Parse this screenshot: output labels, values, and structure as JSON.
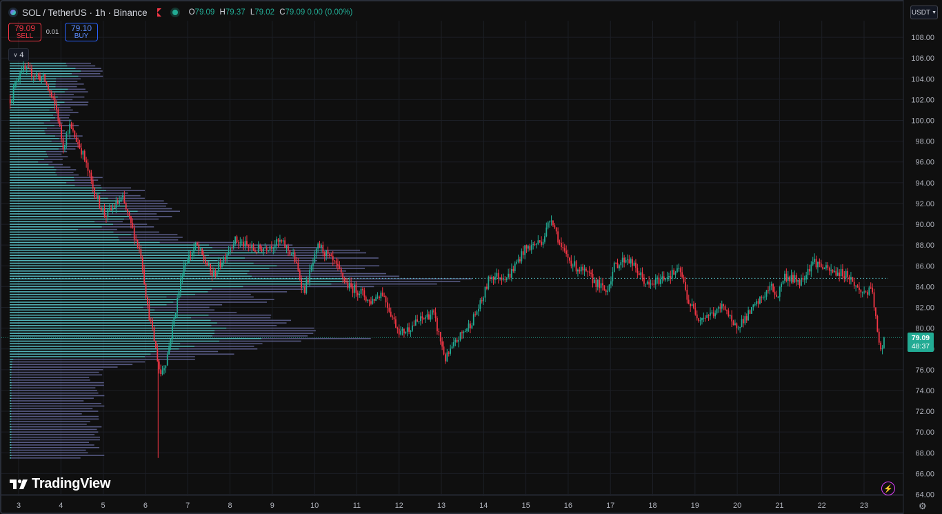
{
  "header": {
    "title": "SOL / TetherUS · 1h · Binance",
    "ohlc": {
      "o_label": "O",
      "o": "79.09",
      "h_label": "H",
      "h": "79.37",
      "l_label": "L",
      "l": "79.02",
      "c_label": "C",
      "c": "79.09",
      "change": "0.00 (0.00%)"
    }
  },
  "trade": {
    "sell_price": "79.09",
    "sell_label": "SELL",
    "spread": "0.01",
    "buy_price": "79.10",
    "buy_label": "BUY"
  },
  "indicators_count": "4",
  "currency": "USDT",
  "last_price": {
    "value": "79.09",
    "countdown": "48:37"
  },
  "brand": "TradingView",
  "colors": {
    "up": "#22ab94",
    "down": "#f23645",
    "vp_up": "#5ecfd6",
    "vp_down": "#6d72a8",
    "background": "#0f0f0f"
  },
  "icons": [
    "sol-coin-icon",
    "flag-icon",
    "market-status-icon",
    "chevron-down-icon",
    "tradingview-logo-icon",
    "lightning-icon",
    "settings-gear-icon"
  ],
  "chart_data": {
    "type": "candlestick",
    "title": "SOL / TetherUS · 1h · Binance",
    "x_ticks": [
      "3",
      "4",
      "5",
      "6",
      "7",
      "8",
      "9",
      "10",
      "11",
      "12",
      "13",
      "14",
      "15",
      "16",
      "17",
      "18",
      "19",
      "20",
      "21",
      "22",
      "23"
    ],
    "y_ticks": [
      "108.00",
      "106.00",
      "104.00",
      "102.00",
      "100.00",
      "98.00",
      "96.00",
      "94.00",
      "92.00",
      "90.00",
      "88.00",
      "86.00",
      "84.00",
      "82.00",
      "80.00",
      "78.00",
      "76.00",
      "74.00",
      "72.00",
      "70.00",
      "68.00",
      "66.00",
      "64.00"
    ],
    "ylim": [
      63.9,
      109.6
    ],
    "price_path": [
      {
        "x": 2.8,
        "y": 102.0
      },
      {
        "x": 3.05,
        "y": 105.0
      },
      {
        "x": 3.6,
        "y": 104.0
      },
      {
        "x": 3.9,
        "y": 101.0
      },
      {
        "x": 4.05,
        "y": 97.5
      },
      {
        "x": 4.2,
        "y": 99.5
      },
      {
        "x": 4.5,
        "y": 97.0
      },
      {
        "x": 4.8,
        "y": 93.0
      },
      {
        "x": 5.05,
        "y": 90.8
      },
      {
        "x": 5.45,
        "y": 92.5
      },
      {
        "x": 5.9,
        "y": 87.0
      },
      {
        "x": 6.05,
        "y": 82.0
      },
      {
        "x": 6.2,
        "y": 79.0
      },
      {
        "x": 6.35,
        "y": 75.5
      },
      {
        "x": 6.5,
        "y": 77.0
      },
      {
        "x": 6.9,
        "y": 86.0
      },
      {
        "x": 7.2,
        "y": 88.0
      },
      {
        "x": 7.6,
        "y": 85.0
      },
      {
        "x": 8.1,
        "y": 88.5
      },
      {
        "x": 8.6,
        "y": 87.5
      },
      {
        "x": 9.2,
        "y": 88.3
      },
      {
        "x": 9.5,
        "y": 87.0
      },
      {
        "x": 9.75,
        "y": 83.5
      },
      {
        "x": 10.1,
        "y": 88.0
      },
      {
        "x": 10.5,
        "y": 86.0
      },
      {
        "x": 10.8,
        "y": 84.0
      },
      {
        "x": 11.1,
        "y": 83.5
      },
      {
        "x": 11.3,
        "y": 82.5
      },
      {
        "x": 11.6,
        "y": 83.5
      },
      {
        "x": 11.9,
        "y": 80.5
      },
      {
        "x": 12.05,
        "y": 79.5
      },
      {
        "x": 12.4,
        "y": 80.5
      },
      {
        "x": 12.8,
        "y": 81.5
      },
      {
        "x": 13.1,
        "y": 77.0
      },
      {
        "x": 13.4,
        "y": 79.0
      },
      {
        "x": 13.7,
        "y": 80.5
      },
      {
        "x": 13.95,
        "y": 82.5
      },
      {
        "x": 14.15,
        "y": 85.0
      },
      {
        "x": 14.6,
        "y": 85.0
      },
      {
        "x": 14.95,
        "y": 87.5
      },
      {
        "x": 15.4,
        "y": 88.5
      },
      {
        "x": 15.6,
        "y": 90.8
      },
      {
        "x": 15.85,
        "y": 87.5
      },
      {
        "x": 16.15,
        "y": 86.0
      },
      {
        "x": 16.5,
        "y": 85.0
      },
      {
        "x": 16.9,
        "y": 83.5
      },
      {
        "x": 17.1,
        "y": 86.0
      },
      {
        "x": 17.4,
        "y": 86.8
      },
      {
        "x": 17.9,
        "y": 84.0
      },
      {
        "x": 18.3,
        "y": 85.0
      },
      {
        "x": 18.65,
        "y": 85.5
      },
      {
        "x": 18.85,
        "y": 82.5
      },
      {
        "x": 19.1,
        "y": 81.0
      },
      {
        "x": 19.5,
        "y": 81.5
      },
      {
        "x": 19.7,
        "y": 82.3
      },
      {
        "x": 19.9,
        "y": 80.0
      },
      {
        "x": 20.2,
        "y": 81.0
      },
      {
        "x": 20.6,
        "y": 83.0
      },
      {
        "x": 20.8,
        "y": 84.0
      },
      {
        "x": 20.95,
        "y": 83.0
      },
      {
        "x": 21.1,
        "y": 85.0
      },
      {
        "x": 21.5,
        "y": 84.5
      },
      {
        "x": 21.8,
        "y": 86.5
      },
      {
        "x": 22.15,
        "y": 85.5
      },
      {
        "x": 22.6,
        "y": 85.2
      },
      {
        "x": 22.9,
        "y": 83.5
      },
      {
        "x": 23.2,
        "y": 83.5
      },
      {
        "x": 23.3,
        "y": 80.0
      },
      {
        "x": 23.38,
        "y": 77.6
      },
      {
        "x": 23.5,
        "y": 79.09
      }
    ],
    "volume_profile": {
      "price_step": 0.25,
      "volumes": [
        {
          "price": 104.5,
          "v": 20
        },
        {
          "price": 102.0,
          "v": 17
        },
        {
          "price": 100.0,
          "v": 14
        },
        {
          "price": 98.0,
          "v": 16
        },
        {
          "price": 96.0,
          "v": 12
        },
        {
          "price": 94.0,
          "v": 22
        },
        {
          "price": 92.5,
          "v": 34
        },
        {
          "price": 91.5,
          "v": 40
        },
        {
          "price": 90.5,
          "v": 32
        },
        {
          "price": 89.5,
          "v": 30
        },
        {
          "price": 88.5,
          "v": 44
        },
        {
          "price": 87.5,
          "v": 74
        },
        {
          "price": 86.5,
          "v": 80
        },
        {
          "price": 85.8,
          "v": 92
        },
        {
          "price": 85.0,
          "v": 100
        },
        {
          "price": 84.5,
          "v": 96
        },
        {
          "price": 83.8,
          "v": 80
        },
        {
          "price": 83.0,
          "v": 60
        },
        {
          "price": 82.0,
          "v": 50
        },
        {
          "price": 81.0,
          "v": 62
        },
        {
          "price": 80.0,
          "v": 72
        },
        {
          "price": 79.3,
          "v": 80
        },
        {
          "price": 78.5,
          "v": 70
        },
        {
          "price": 77.5,
          "v": 48
        },
        {
          "price": 76.5,
          "v": 30
        },
        {
          "price": 75.5,
          "v": 20
        },
        {
          "price": 74.0,
          "v": 20
        },
        {
          "price": 72.0,
          "v": 20
        },
        {
          "price": 70.0,
          "v": 20
        },
        {
          "price": 67.5,
          "v": 20
        }
      ],
      "poc_price": 84.8
    },
    "last_price": 79.09,
    "poc_price": 84.8,
    "grid": true
  }
}
